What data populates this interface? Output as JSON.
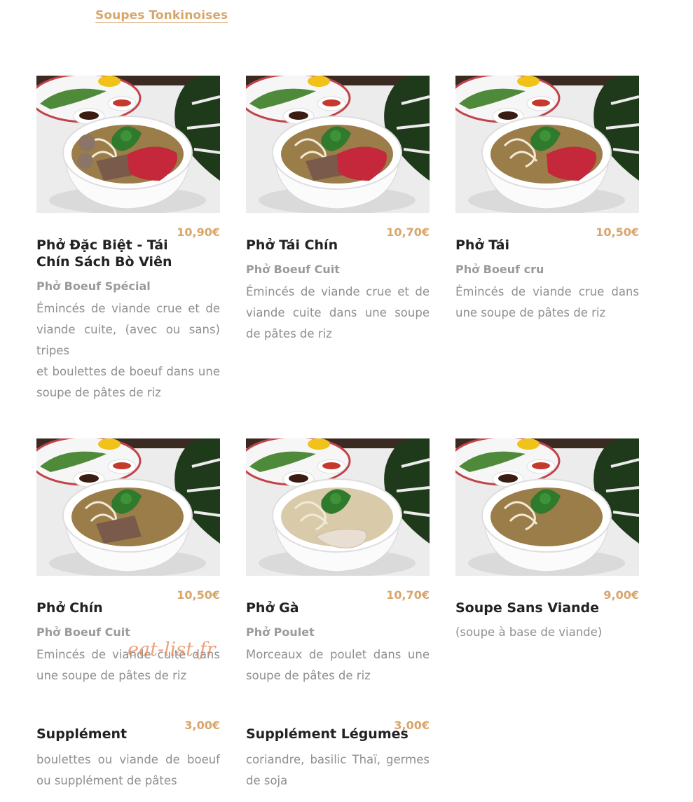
{
  "category": {
    "label": "Soupes Tonkinoises"
  },
  "items": [
    {
      "title": "Phở Đặc Biệt - Tái Chín Sách Bò Viên",
      "price": "10,90€",
      "subtitle": "Phở Boeuf Spécial",
      "description": "Émincés de viande crue et de viande cuite, (avec ou sans) tripes",
      "description_2": "et boulettes de boeuf dans une soupe de pâtes de riz",
      "photo": {
        "beef_raw": true,
        "beef_cooked": true,
        "meatballs": true,
        "chicken": false
      }
    },
    {
      "title": "Phở Tái Chín",
      "price": "10,70€",
      "subtitle": "Phở Boeuf Cuit",
      "description": "Émincés de viande crue et de viande cuite dans une soupe de pâtes de riz",
      "photo": {
        "beef_raw": true,
        "beef_cooked": true,
        "meatballs": false,
        "chicken": false
      }
    },
    {
      "title": "Phở Tái",
      "price": "10,50€",
      "subtitle": "Phở Boeuf cru",
      "description": "Émincés de viande crue dans une soupe de pâtes de riz",
      "photo": {
        "beef_raw": true,
        "beef_cooked": false,
        "meatballs": false,
        "chicken": false
      }
    },
    {
      "title": "Phở Chín",
      "price": "10,50€",
      "subtitle": "Phở Boeuf Cuit",
      "description": "Emincés de viande cuite dans une soupe de pâtes de riz",
      "photo": {
        "beef_raw": false,
        "beef_cooked": true,
        "meatballs": false,
        "chicken": false
      }
    },
    {
      "title": "Phở Gà",
      "price": "10,70€",
      "subtitle": "Phở Poulet",
      "description": "Morceaux de poulet dans une soupe de pâtes de riz",
      "photo": {
        "beef_raw": false,
        "beef_cooked": false,
        "meatballs": false,
        "chicken": true
      }
    },
    {
      "title": "Soupe Sans Viande",
      "price": "9,00€",
      "description": "(soupe à base de viande)",
      "photo": {
        "beef_raw": false,
        "beef_cooked": false,
        "meatballs": false,
        "chicken": false
      }
    }
  ],
  "supplements": [
    {
      "title": "Supplément",
      "price": "3,00€",
      "description": "boulettes ou viande de boeuf ou supplément de pâtes"
    },
    {
      "title": "Supplément Légumes",
      "price": "3,00€",
      "description": "coriandre, basilic Thaï, germes de soja"
    }
  ],
  "watermark": "eat-list.fr",
  "colors": {
    "accent": "#d8a56b",
    "title": "#222222",
    "subtitle": "#9a9a9a",
    "body": "#8f8f8f"
  }
}
